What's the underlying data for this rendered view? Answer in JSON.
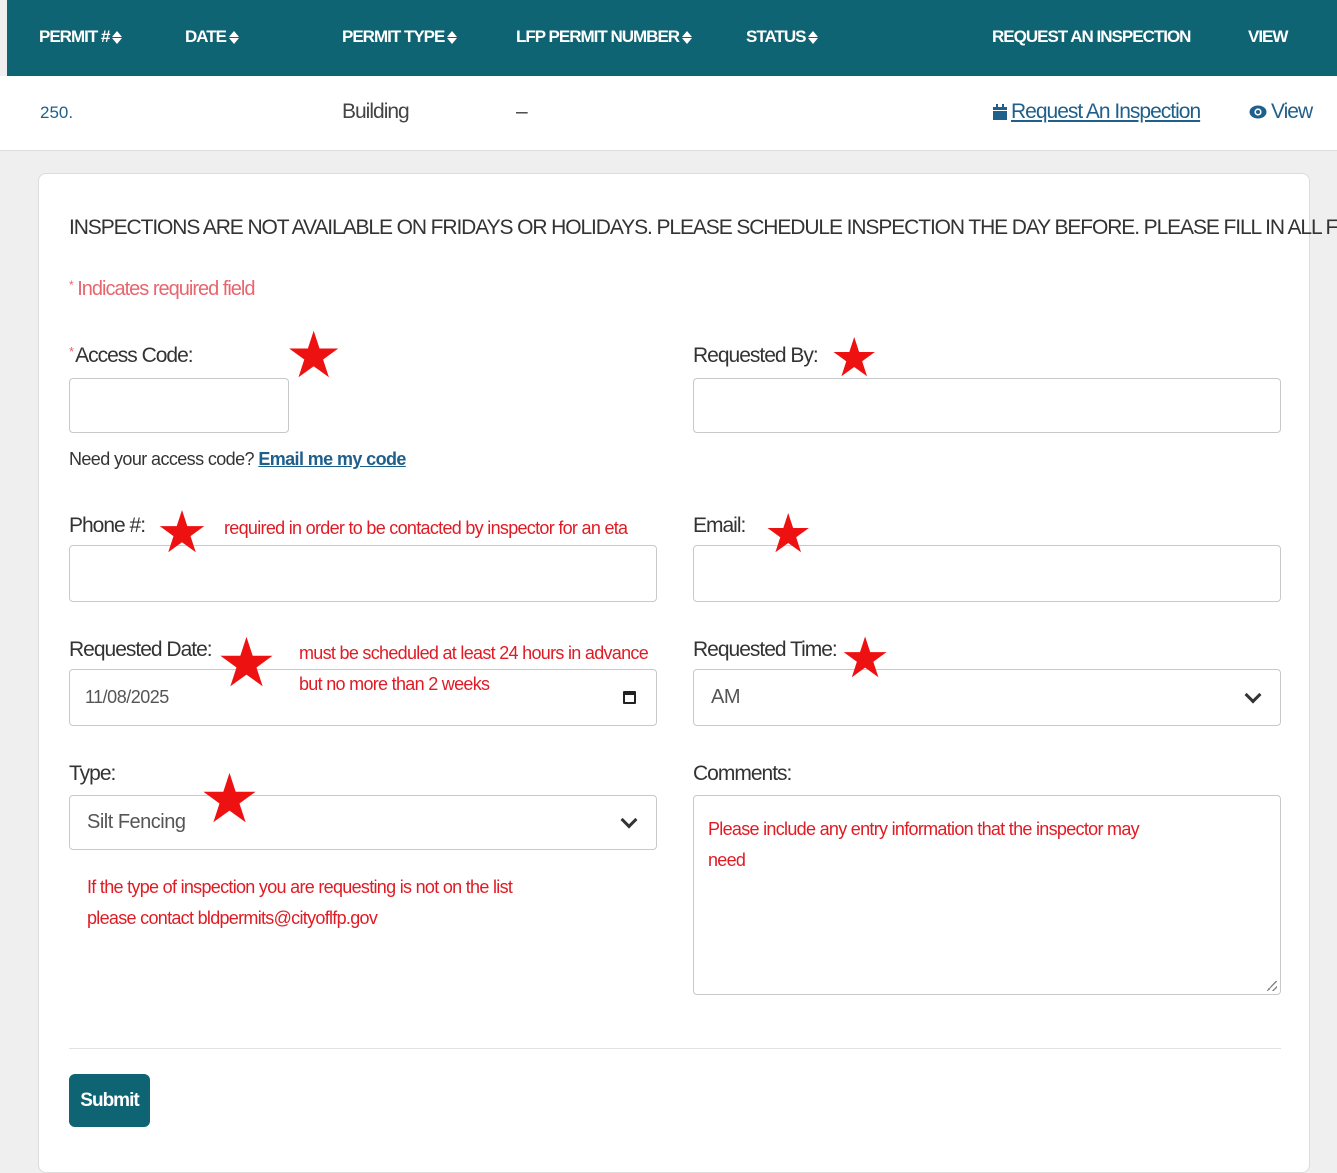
{
  "table": {
    "headers": [
      {
        "label": "PERMIT #",
        "sortable": true
      },
      {
        "label": "DATE",
        "sortable": true
      },
      {
        "label": "PERMIT TYPE",
        "sortable": true
      },
      {
        "label": "LFP PERMIT NUMBER",
        "sortable": true
      },
      {
        "label": "STATUS",
        "sortable": true
      },
      {
        "label": "REQUEST AN INSPECTION",
        "sortable": false
      },
      {
        "label": "VIEW",
        "sortable": false
      }
    ],
    "row": {
      "permit_number": "250.",
      "date": "",
      "permit_type": "Building",
      "lfp_permit_number": "–",
      "status": "",
      "request_link": "Request An Inspection",
      "view_link": "View"
    }
  },
  "form": {
    "notice": "INSPECTIONS ARE NOT AVAILABLE ON FRIDAYS OR HOLIDAYS. PLEASE SCHEDULE INSPECTION THE DAY BEFORE. PLEASE FILL IN ALL FIELDS",
    "required_note": "Indicates required field",
    "required_marker": "*",
    "access_code": {
      "label": "Access Code:",
      "value": ""
    },
    "access_help": {
      "text": "Need your access code? ",
      "link": "Email me my code"
    },
    "requested_by": {
      "label": "Requested By:",
      "value": ""
    },
    "phone": {
      "label": "Phone #:",
      "value": ""
    },
    "email": {
      "label": "Email:",
      "value": ""
    },
    "requested_date": {
      "label": "Requested Date:",
      "value": "11/08/2025"
    },
    "requested_time": {
      "label": "Requested Time:",
      "selected": "AM"
    },
    "type": {
      "label": "Type:",
      "selected": "Silt Fencing"
    },
    "comments": {
      "label": "Comments:",
      "value": ""
    },
    "submit_label": "Submit"
  },
  "annotations": {
    "phone_note": "required in order to be contacted by inspector for an eta",
    "date_note_line1": "must be scheduled at least 24 hours in advance",
    "date_note_line2": "but no more than 2 weeks",
    "type_note_line1": "If the type of inspection you are requesting is not on the list",
    "type_note_line2": "please contact bldpermits@cityoflfp.gov",
    "comments_note_line1": "Please include any entry information that the inspector may",
    "comments_note_line2": "need",
    "star_glyph": "★",
    "star_color": "#ee1111"
  },
  "colors": {
    "header_bg": "#0f6474",
    "link": "#1f5f8b",
    "required": "#e8656e",
    "annotation": "#e01b24"
  }
}
